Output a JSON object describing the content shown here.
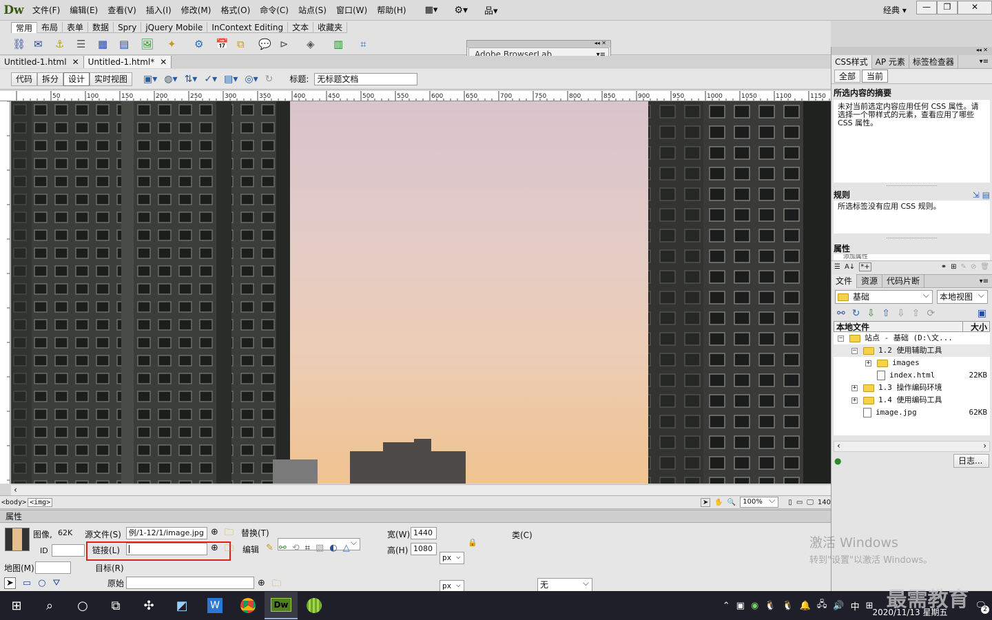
{
  "app": {
    "logo": "Dw",
    "menus": [
      "文件(F)",
      "编辑(E)",
      "查看(V)",
      "插入(I)",
      "修改(M)",
      "格式(O)",
      "命令(C)",
      "站点(S)",
      "窗口(W)",
      "帮助(H)"
    ],
    "workspace": "经典"
  },
  "insert_bar": {
    "tabs": [
      "常用",
      "布局",
      "表单",
      "数据",
      "Spry",
      "jQuery Mobile",
      "InContext Editing",
      "文本",
      "收藏夹"
    ],
    "active": "常用"
  },
  "browserlab": {
    "title": "Adobe BrowserLab"
  },
  "doc_tabs": [
    "Untitled-1.html",
    "Untitled-1.html*"
  ],
  "doc_toolbar": {
    "views": [
      "代码",
      "拆分",
      "设计",
      "实时视图"
    ],
    "active_view": "设计",
    "title_label": "标题:",
    "title_value": "无标题文档"
  },
  "ruler": {
    "ticks": [
      "50",
      "100",
      "150",
      "200",
      "250",
      "300",
      "350",
      "400",
      "450",
      "500",
      "550",
      "600",
      "650",
      "700",
      "750",
      "800",
      "850",
      "900",
      "950",
      "1000",
      "1050",
      "1100",
      "1150"
    ]
  },
  "status_bar": {
    "tags": [
      "<body>",
      "<img>"
    ],
    "zoom": "100%",
    "width_readout": "140"
  },
  "properties": {
    "header": "属性",
    "image_label": "图像,",
    "image_size": "62K",
    "id_label": "ID",
    "src_label": "源文件(S)",
    "src_value": "例/1-12/1/image.jpg",
    "link_label": "链接(L)",
    "link_value": "",
    "alt_label": "替换(T)",
    "alt_value": "",
    "edit_label": "编辑",
    "width_label": "宽(W)",
    "width_value": "1440",
    "height_label": "高(H)",
    "height_value": "1080",
    "unit": "px",
    "class_label": "类(C)",
    "class_value": "无",
    "map_label": "地图(M)",
    "target_label": "目标(R)",
    "original_label": "原始",
    "highlight_color": "#e02020"
  },
  "css_panel": {
    "tabs": [
      "CSS样式",
      "AP 元素",
      "标签检查器"
    ],
    "mode_tabs": [
      "全部",
      "当前"
    ],
    "summary_title": "所选内容的摘要",
    "summary_text": "未对当前选定内容应用任何 CSS 属性。请选择一个带样式的元素，查看应用了哪些 CSS 属性。",
    "rules_title": "规则",
    "rules_text": "所选标签没有应用 CSS 规则。",
    "props_title": "属性",
    "props_add": "添加属性"
  },
  "files_panel": {
    "tabs": [
      "文件",
      "资源",
      "代码片断"
    ],
    "site": "基础",
    "view": "本地视图",
    "col_local": "本地文件",
    "col_size": "大小",
    "tree": [
      {
        "label": "站点 - 基础 (D:\\文...",
        "size": "",
        "level": 0,
        "type": "folder",
        "exp": "−"
      },
      {
        "label": "1.2 使用辅助工具",
        "size": "",
        "level": 1,
        "type": "folder",
        "exp": "−"
      },
      {
        "label": "images",
        "size": "",
        "level": 2,
        "type": "folder",
        "exp": "+"
      },
      {
        "label": "index.html",
        "size": "22KB",
        "level": 2,
        "type": "file",
        "exp": ""
      },
      {
        "label": "1.3 操作编码环境",
        "size": "",
        "level": 1,
        "type": "folder",
        "exp": "+"
      },
      {
        "label": "1.4 使用编码工具",
        "size": "",
        "level": 1,
        "type": "folder",
        "exp": "+"
      },
      {
        "label": "image.jpg",
        "size": "62KB",
        "level": 1,
        "type": "file",
        "exp": ""
      }
    ],
    "log_button": "日志..."
  },
  "watermark": {
    "line1": "激活 Windows",
    "line2": "转到\"设置\"以激活 Windows。"
  },
  "taskbar": {
    "ime": "中",
    "date": "2020/11/13 星期五",
    "brand": "最需教育",
    "notify_count": "2"
  },
  "colors": {
    "accent": "#1a3e8a",
    "taskbar": "#1f1f2a",
    "dw_green": "#4f7f1e"
  }
}
